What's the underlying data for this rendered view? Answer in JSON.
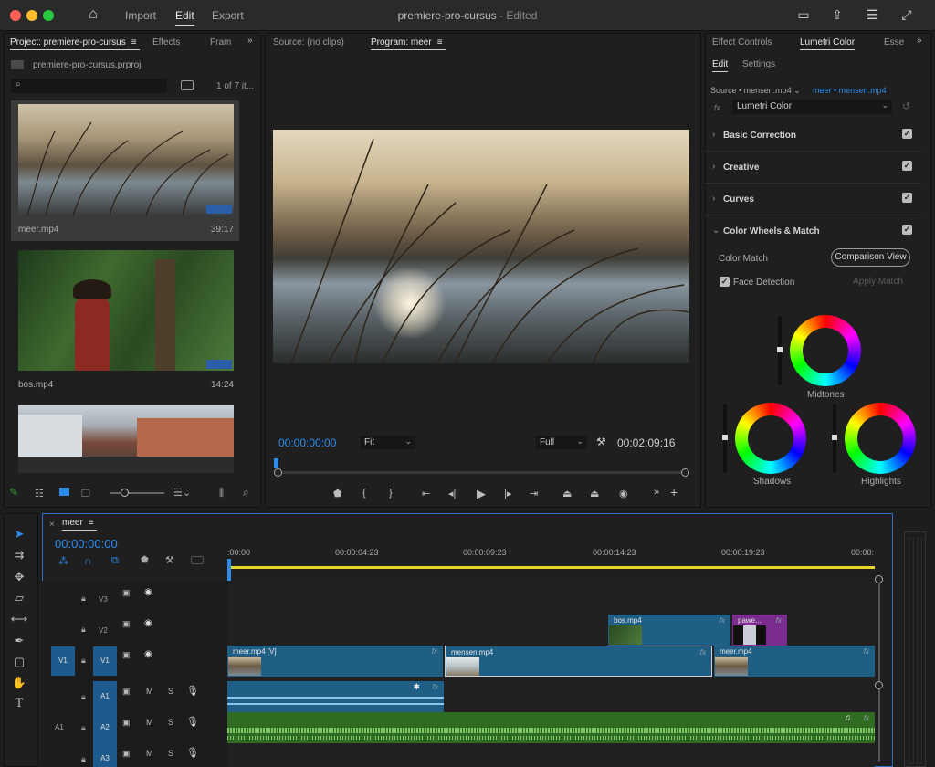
{
  "titlebar": {
    "workspaces": [
      "Import",
      "Edit",
      "Export"
    ],
    "title": "premiere-pro-cursus",
    "status": "Edited"
  },
  "project": {
    "tabs": [
      "Project: premiere-pro-cursus",
      "Effects",
      "Fram"
    ],
    "file": "premiere-pro-cursus.prproj",
    "count": "1 of 7 it...",
    "clips": [
      {
        "name": "meer.mp4",
        "duration": "39:17"
      },
      {
        "name": "bos.mp4",
        "duration": "14:24"
      }
    ]
  },
  "monitor": {
    "source_tab": "Source: (no clips)",
    "program_tab": "Program: meer",
    "timecode": "00:00:00:00",
    "fit": "Fit",
    "quality": "Full",
    "duration": "00:02:09:16"
  },
  "lumetri": {
    "tabs": [
      "Effect Controls",
      "Lumetri Color",
      "Essen"
    ],
    "subtabs": [
      "Edit",
      "Settings"
    ],
    "source": "Source • mensen.mp4",
    "target": "meer • mensen.mp4",
    "effect": "Lumetri Color",
    "sections": [
      "Basic Correction",
      "Creative",
      "Curves",
      "Color Wheels & Match"
    ],
    "color_match": "Color Match",
    "comparison_view": "Comparison View",
    "face_detection": "Face Detection",
    "apply_match": "Apply Match",
    "wheels": [
      "Midtones",
      "Shadows",
      "Highlights"
    ]
  },
  "timeline": {
    "tab": "meer",
    "timecode": "00:00:00:00",
    "ruler": [
      ":00:00",
      "00:00:04:23",
      "00:00:09:23",
      "00:00:14:23",
      "00:00:19:23",
      "00:00:"
    ],
    "video_tracks": [
      "V3",
      "V2",
      "V1"
    ],
    "audio_tracks": [
      "A1",
      "A2",
      "A3"
    ],
    "source_v": "V1",
    "source_a": "A1",
    "mute": "M",
    "solo": "S",
    "clips": {
      "bos": "bos.mp4",
      "pawe": "pawe...",
      "meer_v": "meer.mp4 [V]",
      "mensen": "mensen.mp4",
      "meer2": "meer.mp4",
      "fx": "fx"
    }
  },
  "colors": {
    "accent": "#2d8ceb",
    "clip_blue": "#1f5f86",
    "clip_purple": "#7a2d8c",
    "audio_green": "#2f6b22",
    "playhead_yellow": "#e8d52a"
  }
}
